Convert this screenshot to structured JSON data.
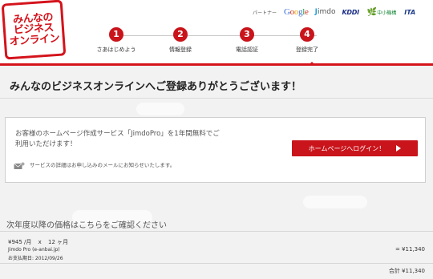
{
  "brand": {
    "logo_lines": [
      "みんなの",
      "ビジネス",
      "オンライン"
    ],
    "accent_color": "#d4131b"
  },
  "partners": {
    "label": "パートナー",
    "google": [
      "G",
      "o",
      "o",
      "g",
      "l",
      "e"
    ],
    "jimdo_mark": "J",
    "jimdo": "imdo",
    "kddi": "KDDI",
    "smrj_leaf": "🌿",
    "smrj": "中小機構",
    "ita": "ITA"
  },
  "steps": [
    {
      "num": "1",
      "label": "さあはじめよう"
    },
    {
      "num": "2",
      "label": "情報登録"
    },
    {
      "num": "3",
      "label": "電話認証"
    },
    {
      "num": "4",
      "label": "登録完了"
    }
  ],
  "main": {
    "title": "みんなのビジネスオンラインへご登録ありがとうございます！",
    "message_line1": "お客様のホームページ作成サービス「JimdoPro」を1年間無料でご",
    "message_line2": "利用いただけます！",
    "login_button": "ホームページへログイン！",
    "note": "サービスの詳細はお申し込みのメールにお知らせいたします。"
  },
  "pricing": {
    "title": "次年度以降の価格はこちらをご確認ください",
    "unit_price": "¥945 /月",
    "times": "x",
    "period": "12 ヶ月",
    "product": "Jimdo Pro (e-anbai.jp)",
    "due_date": "お支払期日: 2012/09/26",
    "subtotal": "= ¥11,340",
    "total": "合計 ¥11,340"
  }
}
